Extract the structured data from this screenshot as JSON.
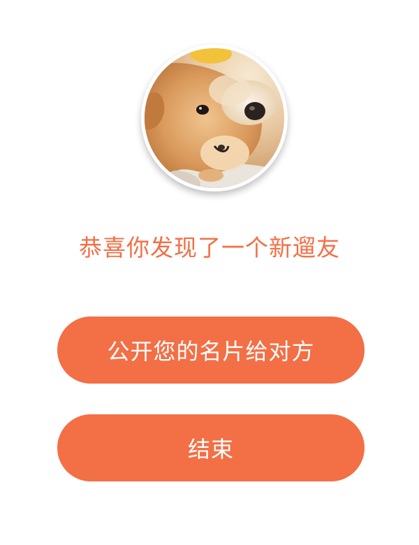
{
  "avatar": {
    "alt": "shiba-dog-avatar"
  },
  "title": "恭喜你发现了一个新遛友",
  "buttons": {
    "share_label": "公开您的名片给对方",
    "end_label": "结束"
  },
  "colors": {
    "accent": "#f36f45",
    "background": "#ffffff",
    "button_text": "#ffffff"
  }
}
